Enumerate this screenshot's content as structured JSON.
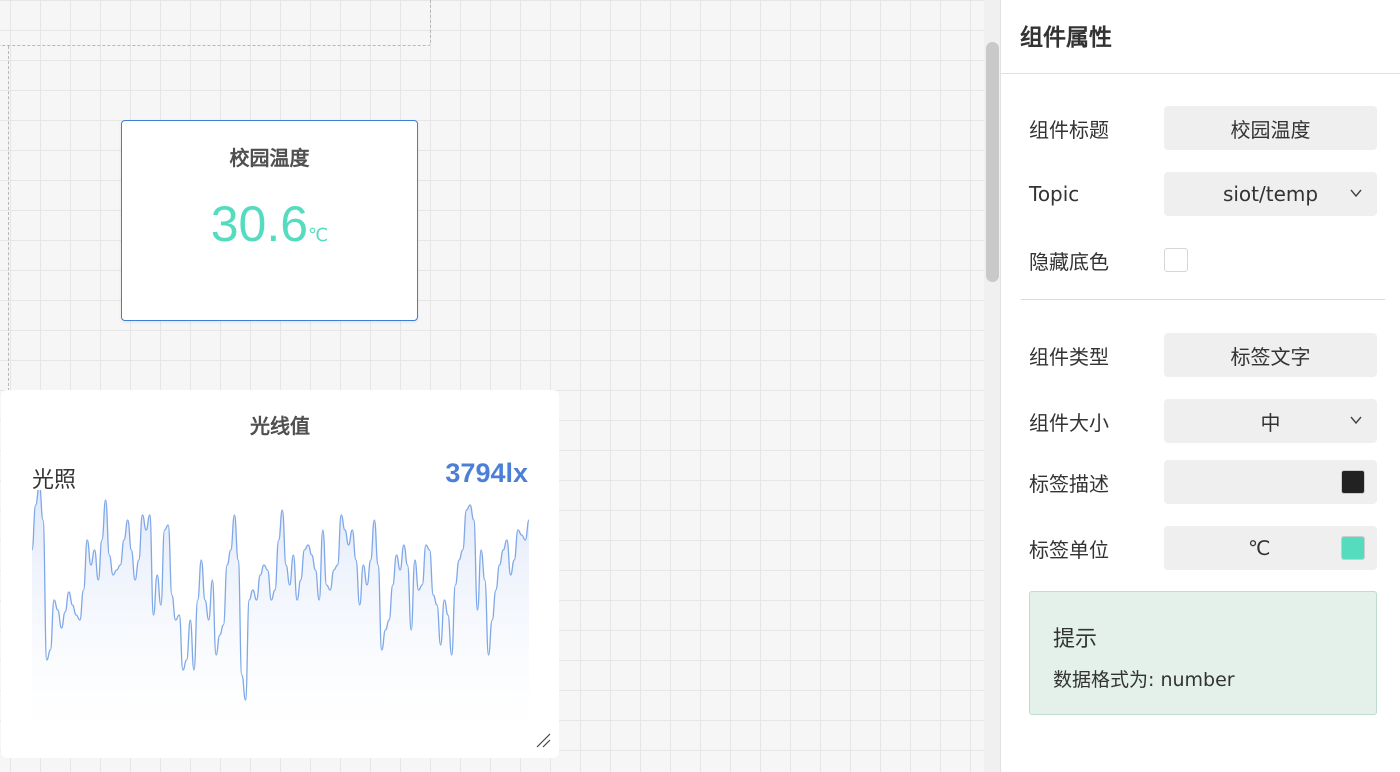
{
  "canvas": {
    "temp_widget": {
      "title": "校园温度",
      "value": "30.6",
      "unit": "℃"
    },
    "light_widget": {
      "title": "光线值",
      "label": "光照",
      "value": "3794lx",
      "series": [
        180,
        225,
        245,
        210,
        70,
        80,
        130,
        120,
        102,
        118,
        138,
        125,
        115,
        110,
        140,
        190,
        165,
        180,
        150,
        190,
        230,
        175,
        155,
        160,
        165,
        190,
        210,
        180,
        150,
        170,
        215,
        200,
        215,
        115,
        155,
        125,
        200,
        205,
        135,
        110,
        115,
        60,
        70,
        110,
        60,
        130,
        170,
        130,
        110,
        150,
        75,
        95,
        105,
        165,
        180,
        215,
        170,
        55,
        30,
        130,
        140,
        130,
        155,
        165,
        160,
        130,
        140,
        190,
        220,
        165,
        145,
        175,
        130,
        150,
        180,
        185,
        175,
        160,
        130,
        200,
        145,
        140,
        160,
        165,
        215,
        200,
        185,
        200,
        170,
        125,
        165,
        145,
        170,
        210,
        165,
        80,
        100,
        110,
        145,
        175,
        160,
        185,
        165,
        100,
        170,
        140,
        145,
        185,
        180,
        135,
        125,
        85,
        130,
        115,
        75,
        145,
        170,
        180,
        220,
        225,
        210,
        120,
        180,
        150,
        75,
        110,
        140,
        165,
        180,
        190,
        155,
        170,
        200,
        195,
        190,
        210
      ],
      "chart_color": "#7fa8e8",
      "fill_color": "#e8eefb"
    },
    "grid_color": "#e6e6e6"
  },
  "panel": {
    "title": "组件属性",
    "rows": {
      "title_label": "组件标题",
      "title_value": "校园温度",
      "topic_label": "Topic",
      "topic_value": "siot/temp",
      "hide_bg_label": "隐藏底色",
      "type_label": "组件类型",
      "type_value": "标签文字",
      "size_label": "组件大小",
      "size_value": "中",
      "desc_label": "标签描述",
      "desc_color": "#222222",
      "unit_label": "标签单位",
      "unit_value": "℃",
      "unit_color": "#55dcbf"
    },
    "tip": {
      "title": "提示",
      "text": "数据格式为: number"
    }
  }
}
